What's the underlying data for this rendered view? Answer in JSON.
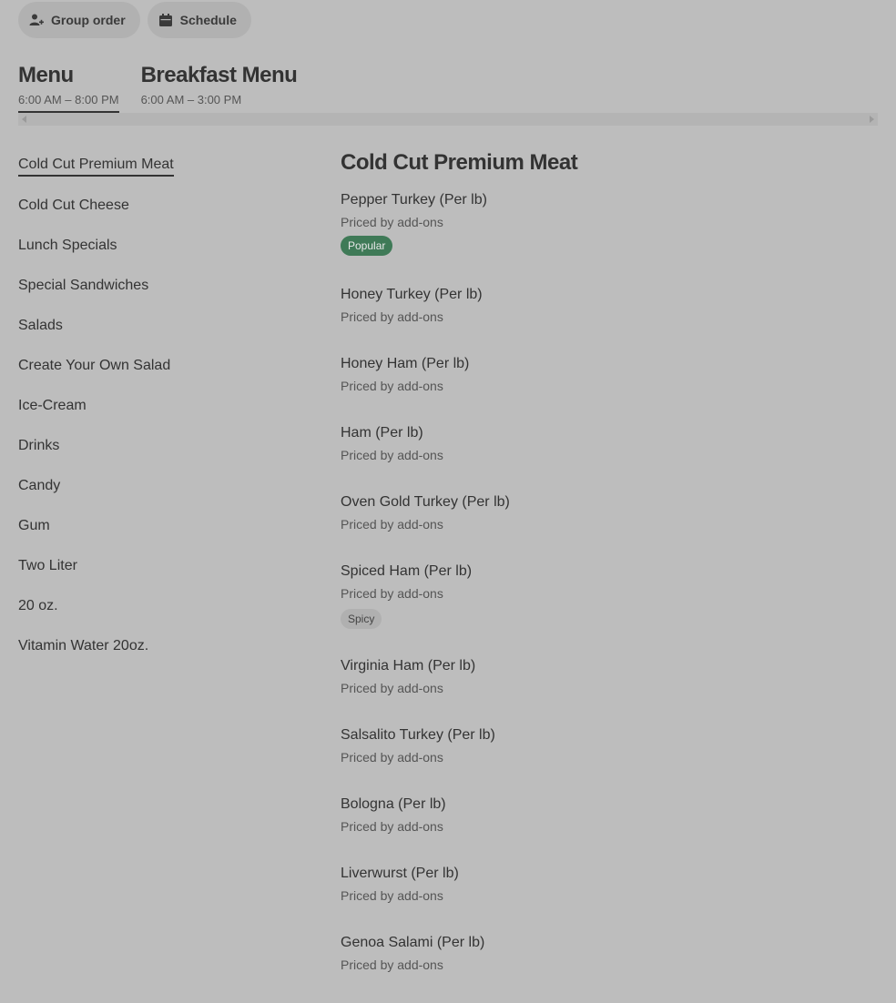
{
  "actions": {
    "group_order": "Group order",
    "schedule": "Schedule"
  },
  "menus": [
    {
      "name": "Menu",
      "hours": "6:00 AM – 8:00 PM",
      "active": true
    },
    {
      "name": "Breakfast Menu",
      "hours": "6:00 AM – 3:00 PM",
      "active": false
    }
  ],
  "categories": [
    "Cold Cut Premium Meat",
    "Cold Cut Cheese",
    "Lunch Specials",
    "Special Sandwiches",
    "Salads",
    "Create Your Own Salad",
    "Ice-Cream",
    "Drinks",
    "Candy",
    "Gum",
    "Two Liter",
    "20 oz.",
    "Vitamin Water 20oz."
  ],
  "section": {
    "title": "Cold Cut Premium Meat",
    "items": [
      {
        "name": "Pepper Turkey (Per lb)",
        "price": "Priced by add-ons",
        "badge": "Popular"
      },
      {
        "name": "Honey Turkey (Per lb)",
        "price": "Priced by add-ons"
      },
      {
        "name": "Honey Ham (Per lb)",
        "price": "Priced by add-ons"
      },
      {
        "name": "Ham (Per lb)",
        "price": "Priced by add-ons"
      },
      {
        "name": "Oven Gold Turkey (Per lb)",
        "price": "Priced by add-ons"
      },
      {
        "name": "Spiced Ham (Per lb)",
        "price": "Priced by add-ons",
        "badge": "Spicy"
      },
      {
        "name": "Virginia Ham (Per lb)",
        "price": "Priced by add-ons"
      },
      {
        "name": "Salsalito Turkey (Per lb)",
        "price": "Priced by add-ons"
      },
      {
        "name": "Bologna (Per lb)",
        "price": "Priced by add-ons"
      },
      {
        "name": "Liverwurst (Per lb)",
        "price": "Priced by add-ons"
      },
      {
        "name": "Genoa Salami (Per lb)",
        "price": "Priced by add-ons"
      }
    ]
  },
  "colors": {
    "background": "#bdbdbd",
    "popular_badge": "#3f7a57",
    "text": "#333333"
  }
}
